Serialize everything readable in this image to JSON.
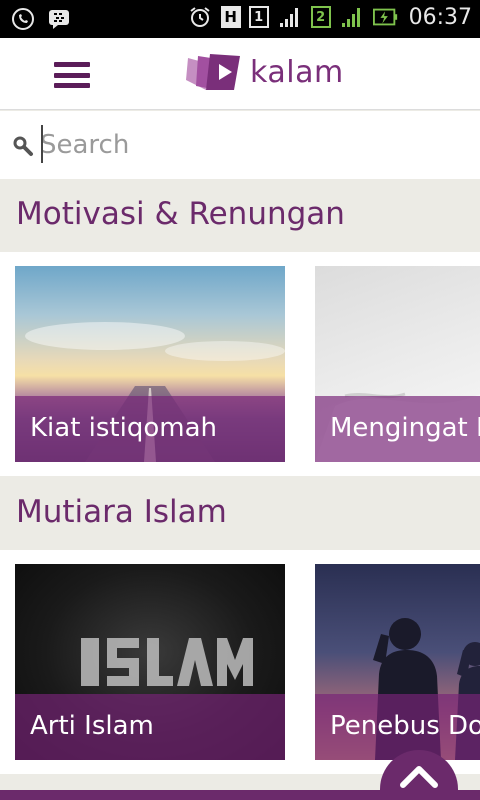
{
  "status_bar": {
    "time": "06:37",
    "sim1_label": "1",
    "sim2_label": "2",
    "network_label": "H"
  },
  "header": {
    "brand": "kalam"
  },
  "search": {
    "placeholder": "Search"
  },
  "sections": [
    {
      "title": "Motivasi & Renungan",
      "cards": [
        {
          "title": "Kiat istiqomah",
          "image": "sky-road"
        },
        {
          "title": "Mengingat Kematian",
          "image": "white-cloth"
        }
      ]
    },
    {
      "title": "Mutiara Islam",
      "cards": [
        {
          "title": "Arti Islam",
          "image": "islam-word-art"
        },
        {
          "title": "Penebus Dosa",
          "image": "praying-people"
        }
      ]
    }
  ],
  "colors": {
    "accent": "#6b2a6b",
    "background": "#ecebe5"
  },
  "icons": [
    "whatsapp-icon",
    "bbm-icon",
    "alarm-icon",
    "signal-icon",
    "battery-charging-icon",
    "search-icon",
    "menu-icon",
    "chevron-up-icon"
  ]
}
